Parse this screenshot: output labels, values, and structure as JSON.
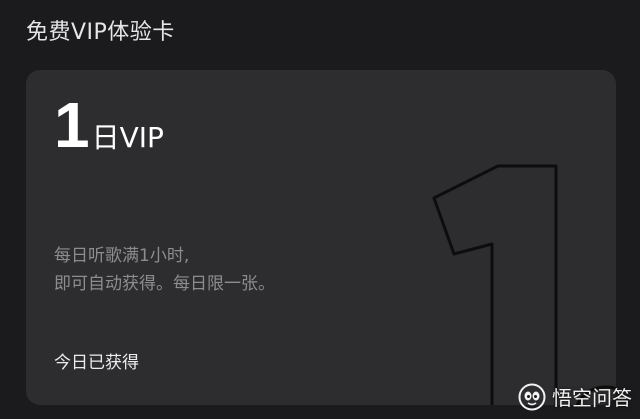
{
  "section": {
    "title": "免费VIP体验卡"
  },
  "card": {
    "number": "1",
    "unit": "日VIP",
    "description_lines": [
      "每日听歌满1小时,",
      "即可自动获得。每日限一张。"
    ],
    "status": "今日已获得",
    "decorative_number": "1"
  },
  "watermark": {
    "text": "悟空问答",
    "icon": "wukong-logo-icon"
  },
  "colors": {
    "page_background": "#1b1b1d",
    "card_background": "#2d2d2f",
    "primary_text": "#ffffff",
    "secondary_text": "#8d8d90"
  }
}
